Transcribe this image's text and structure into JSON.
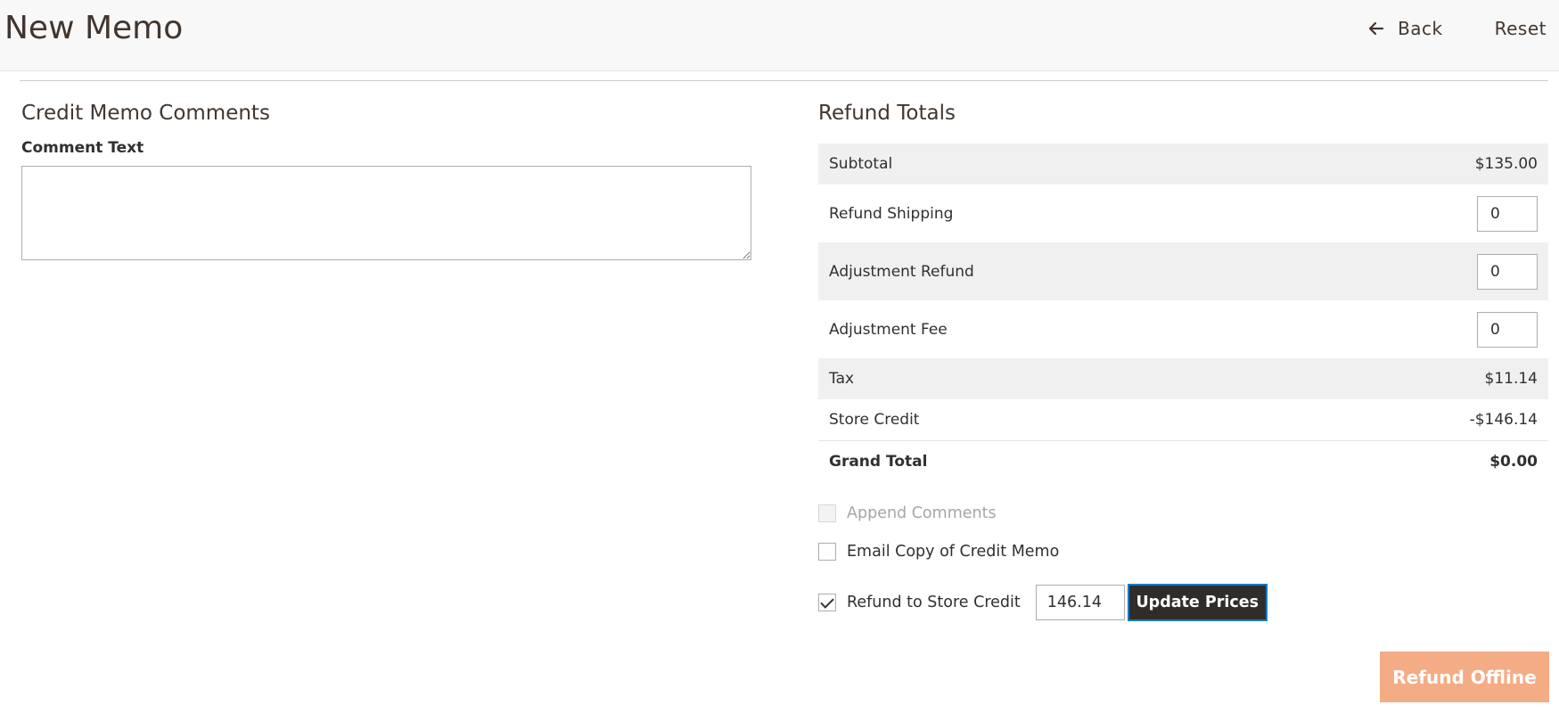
{
  "header": {
    "title": "New Memo",
    "back_label": "Back",
    "reset_label": "Reset"
  },
  "comments": {
    "section_title": "Credit Memo Comments",
    "comment_label": "Comment Text",
    "comment_value": ""
  },
  "totals": {
    "section_title": "Refund Totals",
    "subtotal_label": "Subtotal",
    "subtotal_value": "$135.00",
    "refund_shipping_label": "Refund Shipping",
    "refund_shipping_value": "0",
    "adjustment_refund_label": "Adjustment Refund",
    "adjustment_refund_value": "0",
    "adjustment_fee_label": "Adjustment Fee",
    "adjustment_fee_value": "0",
    "tax_label": "Tax",
    "tax_value": "$11.14",
    "store_credit_label": "Store Credit",
    "store_credit_value": "-$146.14",
    "grand_total_label": "Grand Total",
    "grand_total_value": "$0.00"
  },
  "options": {
    "append_comments_label": "Append Comments",
    "append_comments_checked": false,
    "append_comments_disabled": true,
    "email_copy_label": "Email Copy of Credit Memo",
    "email_copy_checked": false,
    "refund_store_credit_label": "Refund to Store Credit",
    "refund_store_credit_checked": true,
    "refund_store_credit_amount": "146.14",
    "update_prices_label": "Update Prices"
  },
  "actions": {
    "refund_offline_label": "Refund Offline"
  },
  "colors": {
    "header_bg": "#f8f8f8",
    "primary_dark": "#302c2a",
    "refund_offline_bg": "#f4ac85",
    "focus_border": "#1979c3"
  }
}
